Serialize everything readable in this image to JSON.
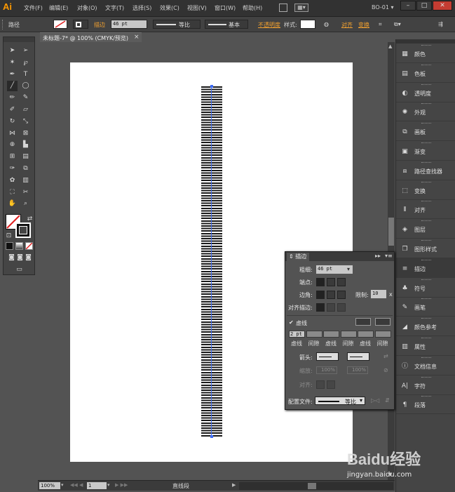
{
  "app": {
    "logo": "Ai",
    "workspace": "BO-01"
  },
  "menu": [
    "文件(F)",
    "编辑(E)",
    "对象(O)",
    "文字(T)",
    "选择(S)",
    "效果(C)",
    "视图(V)",
    "窗口(W)",
    "帮助(H)"
  ],
  "control_bar": {
    "selection_label": "路径",
    "stroke_label": "描边",
    "stroke_weight": "46 pt",
    "profile": "等比",
    "brush": "基本",
    "opacity_label": "不透明度",
    "style_label": "样式:",
    "align_label": "对齐",
    "transform_label": "变换"
  },
  "document": {
    "tab_title": "未标题-7* @ 100% (CMYK/预览)",
    "tab_close": "×"
  },
  "status_bar": {
    "zoom": "100%",
    "page": "1",
    "tool_name": "直线段"
  },
  "dock": [
    {
      "icon": "swatch-icon",
      "glyph": "▦",
      "label": "颜色"
    },
    {
      "icon": "color-guide-icon",
      "glyph": "▤",
      "label": "色板"
    },
    {
      "icon": "transparency-icon",
      "glyph": "◐",
      "label": "透明度"
    },
    {
      "icon": "appearance-icon",
      "glyph": "✺",
      "label": "外观"
    },
    {
      "icon": "artboards-icon",
      "glyph": "⧉",
      "label": "画板"
    },
    {
      "icon": "gradient-icon",
      "glyph": "▣",
      "label": "渐变"
    },
    {
      "icon": "pathfinder-icon",
      "glyph": "⧈",
      "label": "路径查找器"
    },
    {
      "icon": "transform-icon",
      "glyph": "⬚",
      "label": "变换"
    },
    {
      "icon": "align-icon",
      "glyph": "⫴",
      "label": "对齐"
    },
    {
      "icon": "layers-icon",
      "glyph": "◈",
      "label": "图层"
    },
    {
      "icon": "graphic-styles-icon",
      "glyph": "❐",
      "label": "图形样式"
    },
    {
      "icon": "stroke-icon",
      "glyph": "≡",
      "label": "描边"
    },
    {
      "icon": "symbols-icon",
      "glyph": "♣",
      "label": "符号"
    },
    {
      "icon": "brushes-icon",
      "glyph": "✎",
      "label": "画笔"
    },
    {
      "icon": "color-guide-icon",
      "glyph": "◢",
      "label": "颜色参考"
    },
    {
      "icon": "attributes-icon",
      "glyph": "▥",
      "label": "属性"
    },
    {
      "icon": "document-info-icon",
      "glyph": "ⓘ",
      "label": "文档信息"
    },
    {
      "icon": "character-icon",
      "glyph": "A|",
      "label": "字符"
    },
    {
      "icon": "paragraph-icon",
      "glyph": "¶",
      "label": "段落"
    }
  ],
  "stroke_panel": {
    "title": "描边",
    "weight_label": "粗细:",
    "weight_value": "46 pt",
    "cap_label": "端点:",
    "corner_label": "边角:",
    "limit_label": "限制:",
    "limit_value": "10",
    "limit_unit": "x",
    "align_stroke_label": "对齐描边:",
    "dashed_label": "虚线",
    "dashed_checked": true,
    "dash_values": [
      "2 pt",
      "",
      "",
      "",
      "",
      ""
    ],
    "dash_labels": [
      "虚线",
      "间隙",
      "虚线",
      "间隙",
      "虚线",
      "间隙"
    ],
    "arrow_label": "箭头:",
    "scale_label": "缩放:",
    "scale_start": "100%",
    "scale_end": "100%",
    "align_label": "对齐:",
    "profile_label": "配置文件:",
    "profile_value": "等比"
  },
  "watermark": {
    "brand": "Baidu经验",
    "url": "jingyan.baidu.com"
  },
  "colors": {
    "accent_orange": "#f0a030",
    "path_blue": "#3f6df6",
    "close_red": "#c43c32"
  }
}
